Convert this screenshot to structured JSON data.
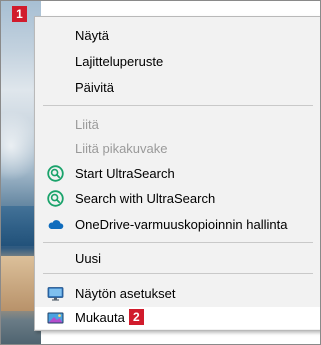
{
  "badges": {
    "first": "1",
    "second": "2"
  },
  "menu": {
    "items": [
      {
        "label": "Näytä",
        "state": "enabled"
      },
      {
        "label": "Lajitteluperuste",
        "state": "enabled"
      },
      {
        "label": "Päivitä",
        "state": "enabled"
      },
      {
        "label": "Liitä",
        "state": "disabled"
      },
      {
        "label": "Liitä pikakuvake",
        "state": "disabled"
      },
      {
        "label": "Start UltraSearch",
        "state": "enabled",
        "icon": "ultrasearch-icon"
      },
      {
        "label": "Search with UltraSearch",
        "state": "enabled",
        "icon": "ultrasearch-icon"
      },
      {
        "label": "OneDrive-varmuuskopioinnin hallinta",
        "state": "enabled",
        "icon": "onedrive-cloud-icon"
      },
      {
        "label": "Uusi",
        "state": "enabled"
      },
      {
        "label": "Näytön asetukset",
        "state": "enabled",
        "icon": "display-settings-icon"
      },
      {
        "label": "Mukauta",
        "state": "highlighted",
        "icon": "personalize-icon"
      }
    ]
  },
  "colors": {
    "badge": "#d11b2c",
    "ultrasearch": "#1aa36b",
    "onedrive": "#0f6cbd",
    "disabled_text": "#9a9a9a"
  }
}
